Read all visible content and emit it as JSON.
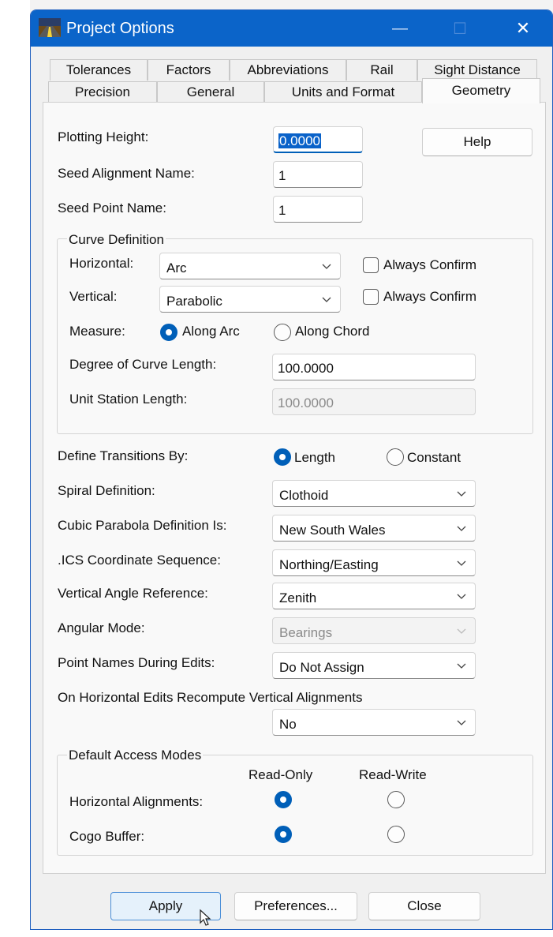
{
  "window": {
    "title": "Project Options",
    "minimize_glyph": "—",
    "maximize_glyph": "☐",
    "close_glyph": "✕"
  },
  "tabs": {
    "row1": [
      "Tolerances",
      "Factors",
      "Abbreviations",
      "Rail",
      "Sight Distance"
    ],
    "row2": [
      "Precision",
      "General",
      "Units and Format",
      "Geometry"
    ],
    "active": "Geometry"
  },
  "fields": {
    "plotting_height": {
      "label": "Plotting Height:",
      "value": "0.0000"
    },
    "seed_alignment": {
      "label": "Seed Alignment Name:",
      "value": "1"
    },
    "seed_point": {
      "label": "Seed Point Name:",
      "value": "1"
    }
  },
  "help_button": "Help",
  "curve_definition": {
    "title": "Curve Definition",
    "horizontal": {
      "label": "Horizontal:",
      "value": "Arc",
      "confirm_label": "Always Confirm"
    },
    "vertical": {
      "label": "Vertical:",
      "value": "Parabolic",
      "confirm_label": "Always Confirm"
    },
    "measure": {
      "label": "Measure:",
      "opt1": "Along Arc",
      "opt2": "Along Chord",
      "selected": "Along Arc"
    },
    "degree_length": {
      "label": "Degree of Curve Length:",
      "value": "100.0000"
    },
    "unit_station": {
      "label": "Unit Station Length:",
      "value": "100.0000"
    }
  },
  "transitions": {
    "label": "Define Transitions By:",
    "opt1": "Length",
    "opt2": "Constant",
    "selected": "Length"
  },
  "dropdowns": [
    {
      "label": "Spiral Definition:",
      "value": "Clothoid",
      "disabled": false
    },
    {
      "label": "Cubic Parabola Definition Is:",
      "value": "New South Wales",
      "disabled": false
    },
    {
      "label": ".ICS Coordinate Sequence:",
      "value": "Northing/Easting",
      "disabled": false
    },
    {
      "label": "Vertical Angle Reference:",
      "value": "Zenith",
      "disabled": false
    },
    {
      "label": "Angular Mode:",
      "value": "Bearings",
      "disabled": true
    },
    {
      "label": "Point Names During Edits:",
      "value": "Do Not Assign",
      "disabled": false
    }
  ],
  "recompute": {
    "label": "On Horizontal Edits Recompute Vertical Alignments",
    "value": "No"
  },
  "access_modes": {
    "title": "Default Access Modes",
    "col1": "Read-Only",
    "col2": "Read-Write",
    "rows": [
      {
        "label": "Horizontal Alignments:",
        "selected": "Read-Only"
      },
      {
        "label": "Cogo Buffer:",
        "selected": "Read-Only"
      }
    ]
  },
  "footer": {
    "apply": "Apply",
    "preferences": "Preferences...",
    "close": "Close"
  },
  "colors": {
    "titlebar": "#0b64c9",
    "accent": "#005fb8"
  },
  "icons": {
    "app": "road-app-icon",
    "chevron": "chevron-down-icon",
    "cursor": "mouse-pointer-icon"
  }
}
